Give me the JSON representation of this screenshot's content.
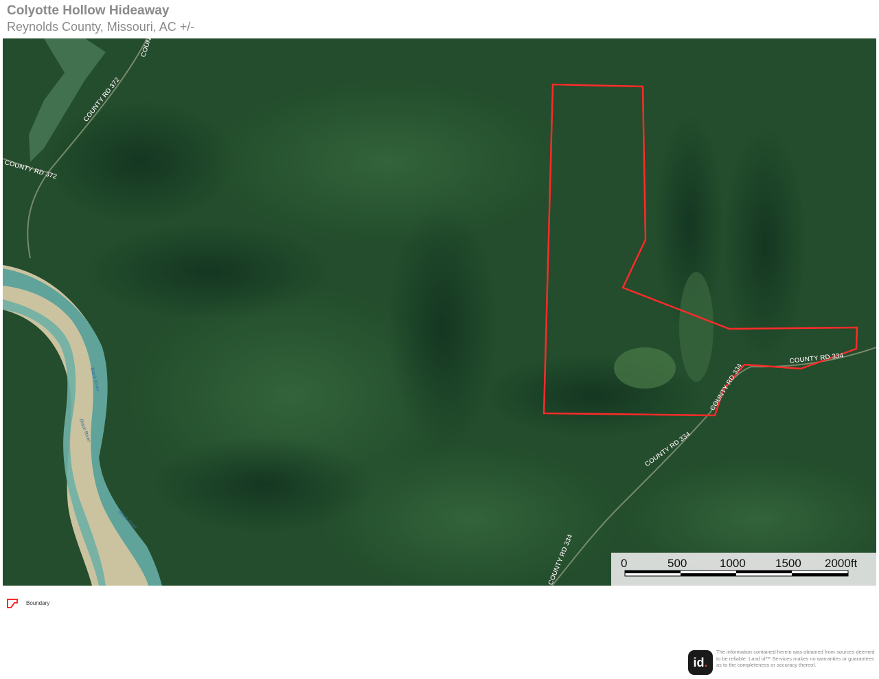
{
  "header": {
    "title": "Colyotte Hollow Hideaway",
    "subtitle": "Reynolds County, Missouri,  AC +/-"
  },
  "map": {
    "type": "satellite",
    "boundary_color": "#ff2a2a",
    "road_labels": [
      "COUNTY RD 372",
      "COUNTY RD 372",
      "COUNTY RD 334",
      "COUNTY RD 334",
      "COUNTY RD 334",
      "COUNTY RD 334",
      "COUNTY"
    ],
    "river_labels": [
      "Black River",
      "Black River",
      "Black River"
    ],
    "scale": {
      "labels": [
        "0",
        "500",
        "1000",
        "1500",
        "2000ft"
      ]
    }
  },
  "legend": {
    "boundary_label": "Boundary"
  },
  "footer": {
    "logo_text": "id",
    "logo_dot": ".",
    "disclaimer": "The information contained herein was obtained from sources deemed to be reliable. Land id™ Services makes no warranties or guarantees as to the completeness or accuracy thereof."
  },
  "colors": {
    "forest": "#1f4a2a",
    "river": "#5fa39a",
    "gravel_bar": "#c9c2a0",
    "boundary": "#ff2a2a"
  }
}
